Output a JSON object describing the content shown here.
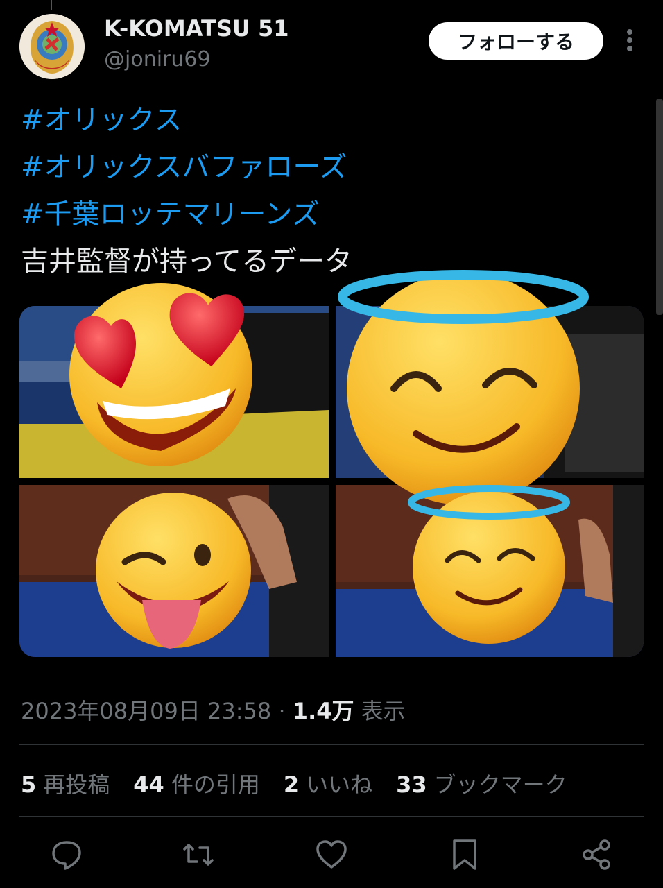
{
  "author": {
    "display_name": "K-KOMATSU 51",
    "handle": "@joniru69",
    "avatar_icon": "state-emblem-avatar"
  },
  "follow_button": {
    "label": "フォローする"
  },
  "more_icon": "more-vertical-icon",
  "tweet": {
    "lines": [
      {
        "text": "#オリックス",
        "kind": "hashtag"
      },
      {
        "text": "#オリックスバファローズ",
        "kind": "hashtag"
      },
      {
        "text": "#千葉ロッテマリーンズ",
        "kind": "hashtag"
      },
      {
        "text": "吉井監督が持ってるデータ",
        "kind": "text"
      }
    ],
    "media": [
      {
        "emoji": "heart-eyes-emoji"
      },
      {
        "emoji": "halo-smile-emoji"
      },
      {
        "emoji": "wink-tongue-emoji"
      },
      {
        "emoji": "halo-smile-emoji"
      }
    ]
  },
  "meta": {
    "timestamp": "2023年08月09日 23:58",
    "separator": "·",
    "views_count": "1.4万",
    "views_label": "表示"
  },
  "stats": [
    {
      "count": "5",
      "label": "再投稿"
    },
    {
      "count": "44",
      "label": "件の引用"
    },
    {
      "count": "2",
      "label": "いいね"
    },
    {
      "count": "33",
      "label": "ブックマーク"
    }
  ],
  "actions": [
    "reply-icon",
    "repost-icon",
    "like-icon",
    "bookmark-icon",
    "share-icon"
  ],
  "colors": {
    "background": "#000000",
    "link": "#1d9bf0",
    "muted": "#71767b",
    "text": "#e7e9ea"
  }
}
